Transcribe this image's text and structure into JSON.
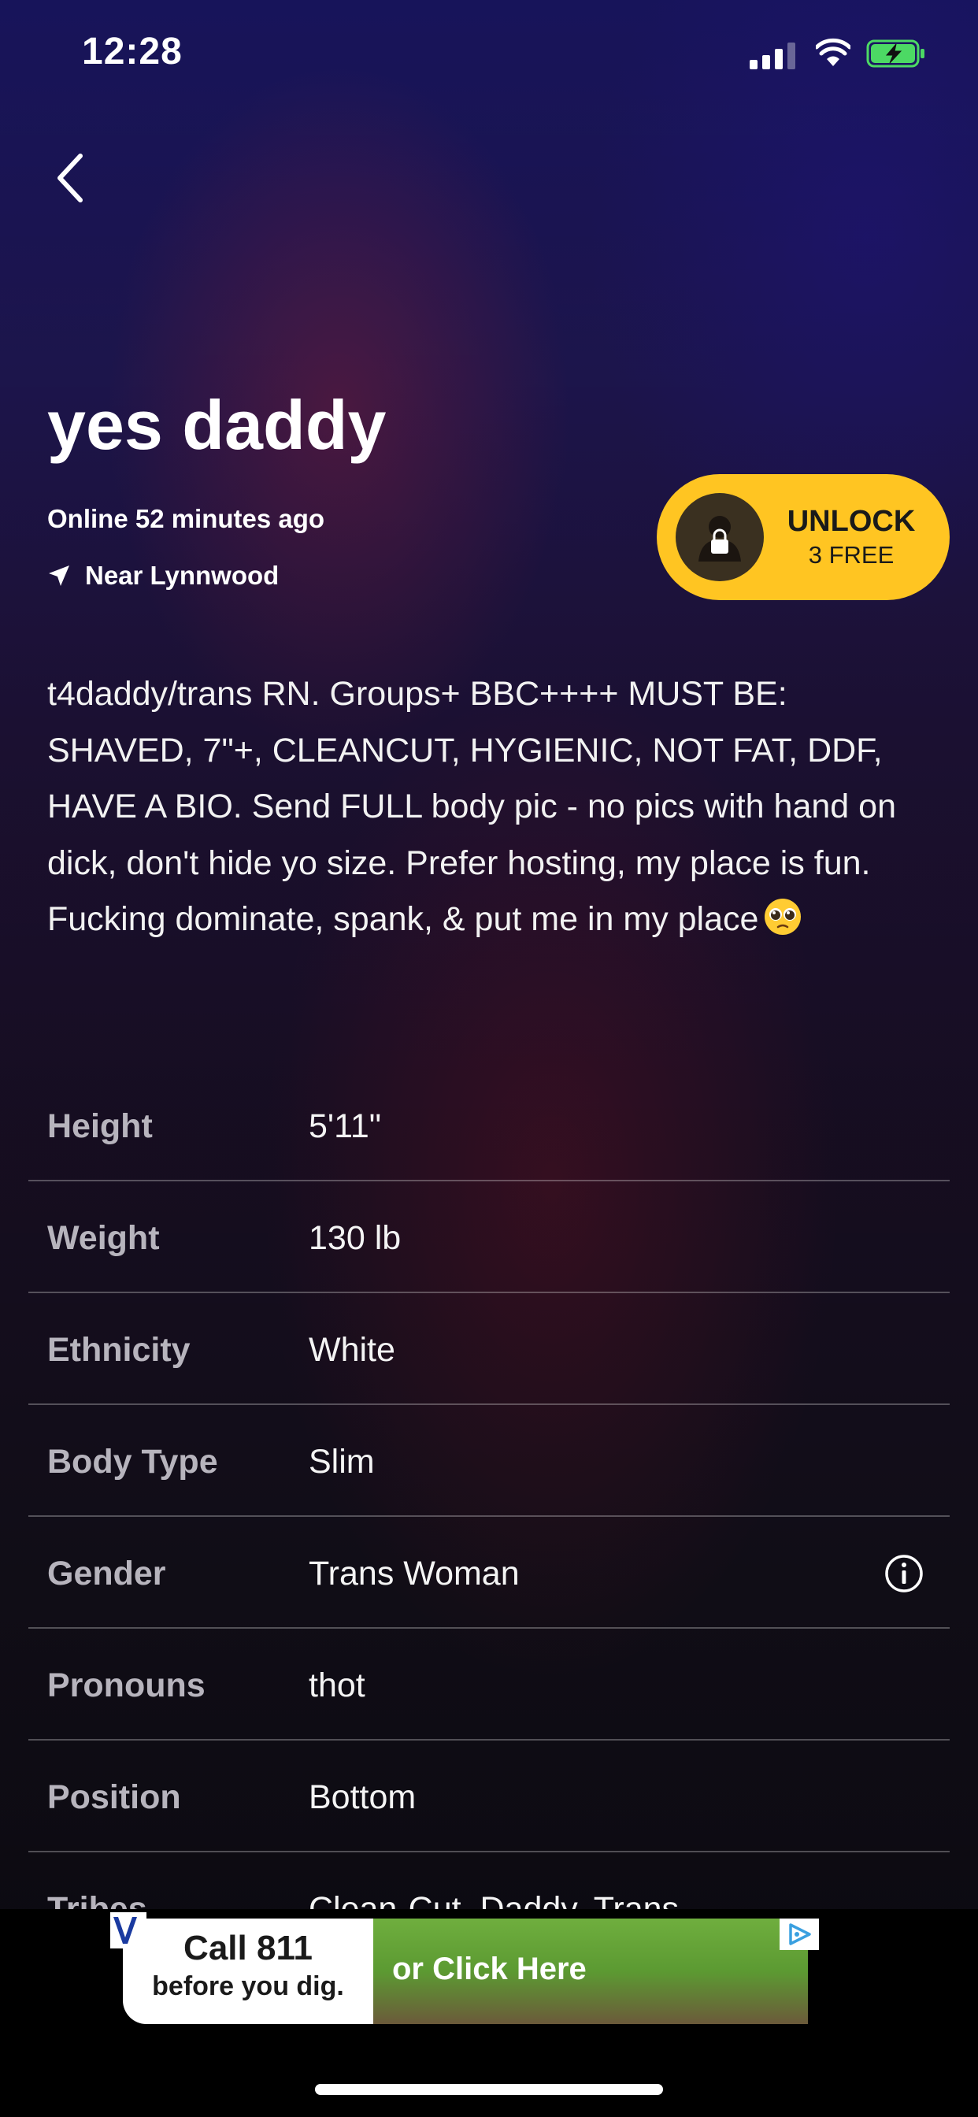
{
  "status_bar": {
    "time": "12:28"
  },
  "profile": {
    "name": "yes daddy",
    "online_status": "Online 52 minutes ago",
    "location": "Near Lynnwood",
    "bio": "t4daddy/trans RN. Groups+ BBC++++ MUST BE: SHAVED, 7\"+, CLEANCUT, HYGIENIC, NOT FAT, DDF, HAVE A BIO. Send FULL body pic - no pics with hand on dick, don't hide yo size. Prefer hosting, my place is fun. Fucking dominate, spank, & put me in my place"
  },
  "unlock": {
    "title": "UNLOCK",
    "subtitle": "3 FREE",
    "color": "#ffc522"
  },
  "stats": [
    {
      "label": "Height",
      "value": "5'11\""
    },
    {
      "label": "Weight",
      "value": "130 lb"
    },
    {
      "label": "Ethnicity",
      "value": "White"
    },
    {
      "label": "Body Type",
      "value": "Slim"
    },
    {
      "label": "Gender",
      "value": "Trans Woman"
    },
    {
      "label": "Pronouns",
      "value": "thot"
    },
    {
      "label": "Position",
      "value": "Bottom"
    },
    {
      "label": "Tribes",
      "value": "Clean-Cut, Daddy, Trans"
    }
  ],
  "ad": {
    "call_text": "Call 811",
    "dig_text": "before you dig.",
    "click_text": "or Click Here"
  },
  "icons": {
    "back": "chevron-left-icon",
    "location": "navigation-arrow-icon",
    "lock": "lock-icon",
    "info": "info-icon"
  }
}
